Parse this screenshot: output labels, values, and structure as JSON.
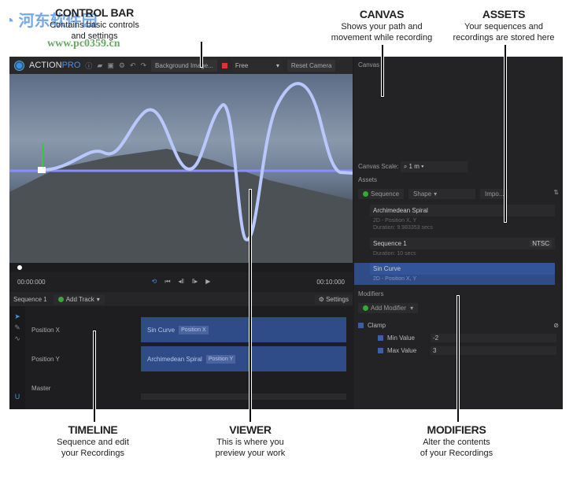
{
  "watermark": {
    "text": "河东软件园",
    "url": "www.pc0359.cn"
  },
  "annotations": {
    "control_bar": {
      "title": "CONTROL BAR",
      "desc1": "Contains basic controls",
      "desc2": "and settings"
    },
    "canvas": {
      "title": "CANVAS",
      "desc1": "Shows your path and",
      "desc2": "movement while recording"
    },
    "assets": {
      "title": "ASSETS",
      "desc1": "Your sequences and",
      "desc2": "recordings are stored here"
    },
    "timeline": {
      "title": "TIMELINE",
      "desc1": "Sequence and edit",
      "desc2": "your Recordings"
    },
    "viewer": {
      "title": "VIEWER",
      "desc1": "This is where you",
      "desc2": "preview your work"
    },
    "modifiers": {
      "title": "MODIFIERS",
      "desc1": "Alter the contents",
      "desc2": "of your Recordings"
    }
  },
  "toolbar": {
    "app_name": "ACTION",
    "app_name_accent": "PRO",
    "background_image": "Background Image...",
    "camera_mode": "Free",
    "reset_camera": "Reset Camera"
  },
  "viewer": {
    "time_start": "00:00:000",
    "time_end": "00:10:000",
    "progress": 0
  },
  "timeline": {
    "sequence": "Sequence 1",
    "add_track": "Add Track",
    "settings": "Settings",
    "tracks": [
      {
        "name": "Position X",
        "clip": "Sin Curve",
        "tag": "Position X"
      },
      {
        "name": "Position Y",
        "clip": "Archimedean Spiral",
        "tag": "Position Y"
      },
      {
        "name": "Master"
      }
    ]
  },
  "canvas": {
    "title": "Canvas",
    "scale_label": "Canvas Scale:",
    "scale_value": "1 m"
  },
  "assets": {
    "title": "Assets",
    "sequence_btn": "Sequence",
    "shape_btn": "Shape",
    "import_btn": "Impo...",
    "items": [
      {
        "name": "Archimedean Spiral",
        "line1": "2D - Position X, Y",
        "line2": "Duration: 9.983353 secs"
      },
      {
        "name": "Sequence 1",
        "badge": "NTSC",
        "line1": "Duration: 10 secs"
      },
      {
        "name": "Sin Curve",
        "line1": "2D - Position X, Y"
      }
    ]
  },
  "modifiers": {
    "title": "Modifiers",
    "add": "Add Modifier",
    "clamp": "Clamp",
    "min_label": "Min Value",
    "min_value": "-2",
    "max_label": "Max Value",
    "max_value": "3"
  }
}
